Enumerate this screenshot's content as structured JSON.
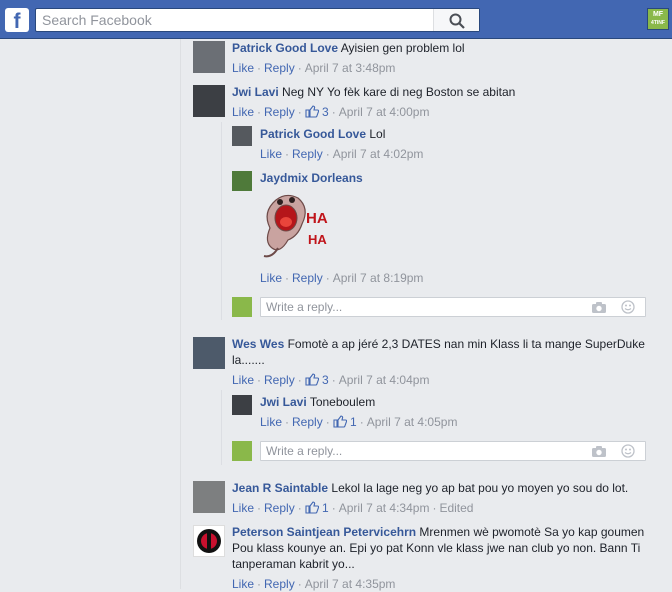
{
  "search": {
    "placeholder": "Search Facebook"
  },
  "header": {
    "logo_letter": "f",
    "profile_badge_top": "MF",
    "profile_badge_bottom": "4TINF"
  },
  "sticker": {
    "text_top": "HA",
    "text_bottom": "HA"
  },
  "reply_placeholder": "Write a reply...",
  "common": {
    "like": "Like",
    "reply": "Reply",
    "dot": "·"
  },
  "comments": [
    {
      "name": "Patrick Good Love",
      "text": "Ayisien gen problem lol",
      "time": "April 7 at 3:48pm"
    },
    {
      "name": "Jwi Lavi",
      "text": "Neg NY Yo fèk kare di neg Boston se abitan",
      "likes": "3",
      "time": "April 7 at 4:00pm"
    },
    {
      "name": "Patrick Good Love",
      "text": "Lol",
      "time": "April 7 at 4:02pm"
    },
    {
      "name": "Jaydmix Dorleans",
      "text": "",
      "time": "April 7 at 8:19pm"
    },
    {
      "name": "Wes Wes",
      "text_line1": "Fomotè a ap jéré 2,3 DATES nan min Klass li ta mange SuperDuke",
      "text_line2": "la.......",
      "likes": "3",
      "time": "April 7 at 4:04pm"
    },
    {
      "name": "Jwi Lavi",
      "text": "Toneboulem",
      "likes": "1",
      "time": "April 7 at 4:05pm"
    },
    {
      "name": "Jean R Saintable",
      "text": "Lekol la lage neg yo ap bat pou yo moyen yo sou do lot.",
      "likes": "1",
      "time": "April 7 at 4:34pm",
      "edited": "Edited"
    },
    {
      "name": "Peterson Saintjean Petervicehrn",
      "text_line1": "Mrenmen wè pwomotè Sa yo kap goumen",
      "text_line2": "Pou klass kounye an. Epi yo pat Konn vle klass jwe nan club yo non. Bann Ti",
      "text_line3": "tanperaman kabrit yo...",
      "time": "April 7 at 4:35pm"
    }
  ]
}
